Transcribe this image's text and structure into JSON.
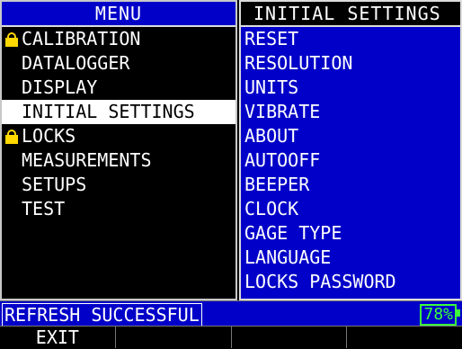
{
  "menu": {
    "title": "MENU",
    "items": [
      {
        "label": "CALIBRATION",
        "locked": true,
        "selected": false
      },
      {
        "label": "DATALOGGER",
        "locked": false,
        "selected": false
      },
      {
        "label": "DISPLAY",
        "locked": false,
        "selected": false
      },
      {
        "label": "INITIAL SETTINGS",
        "locked": false,
        "selected": true
      },
      {
        "label": "LOCKS",
        "locked": true,
        "selected": false
      },
      {
        "label": "MEASUREMENTS",
        "locked": false,
        "selected": false
      },
      {
        "label": "SETUPS",
        "locked": false,
        "selected": false
      },
      {
        "label": "TEST",
        "locked": false,
        "selected": false
      }
    ]
  },
  "submenu": {
    "title": "INITIAL SETTINGS",
    "items": [
      "RESET",
      "RESOLUTION",
      "UNITS",
      "VIBRATE",
      "ABOUT",
      "AUTOOFF",
      "BEEPER",
      "CLOCK",
      "GAGE TYPE",
      "LANGUAGE",
      "LOCKS PASSWORD"
    ]
  },
  "status": {
    "message": "REFRESH SUCCESSFUL",
    "battery": "78%"
  },
  "softkeys": [
    "EXIT",
    "",
    "",
    ""
  ],
  "colors": {
    "panel_blue": "#0000c8",
    "lock_yellow": "#ffd800",
    "battery_green": "#3cff3c"
  }
}
